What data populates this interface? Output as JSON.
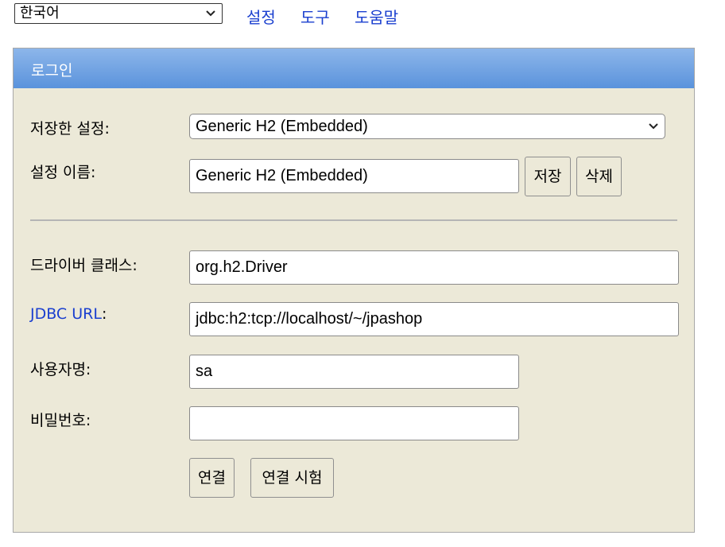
{
  "topbar": {
    "language_selected": "한국어",
    "links": [
      "설정",
      "도구",
      "도움말"
    ]
  },
  "panel": {
    "title": "로그인",
    "saved_settings_label": "저장한 설정:",
    "saved_settings_value": "Generic H2 (Embedded)",
    "setting_name_label": "설정 이름:",
    "setting_name_value": "Generic H2 (Embedded)",
    "save_button": "저장",
    "delete_button": "삭제",
    "driver_class_label": "드라이버 클래스:",
    "driver_class_value": "org.h2.Driver",
    "jdbc_url_label": "JDBC URL",
    "jdbc_url_suffix": ":",
    "jdbc_url_value": "jdbc:h2:tcp://localhost/~/jpashop",
    "username_label": "사용자명:",
    "username_value": "sa",
    "password_label": "비밀번호:",
    "password_value": "",
    "connect_button": "연결",
    "test_connection_button": "연결 시험"
  },
  "colors": {
    "link": "#1a3fcf",
    "panel_bg": "#ece9d8",
    "header_gradient_top": "#8db6ea",
    "header_gradient_bottom": "#5a93dc"
  }
}
